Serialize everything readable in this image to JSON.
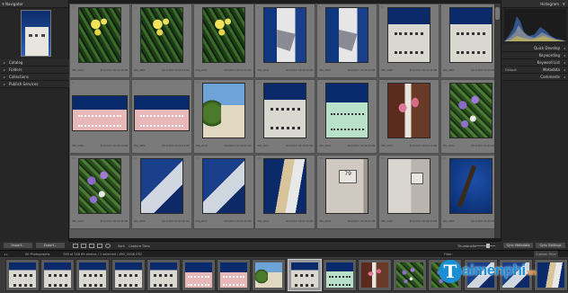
{
  "left_panel": {
    "navigator_label": "Navigator",
    "sections": [
      {
        "label": "Catalog"
      },
      {
        "label": "Folders"
      },
      {
        "label": "Collections"
      },
      {
        "label": "Publish Services"
      }
    ],
    "import_label": "Import...",
    "export_label": "Export..."
  },
  "right_panel": {
    "histogram_label": "Histogram",
    "sections": [
      {
        "label": "Quick Develop"
      },
      {
        "label": "Keywording"
      },
      {
        "label": "Keyword List"
      },
      {
        "label": "Metadata"
      },
      {
        "label": "Comments"
      }
    ],
    "metadata_preset": "Default",
    "sync_label": "Sync Metadata",
    "sync_settings_label": "Sync Settings"
  },
  "grid": {
    "cells": [
      {
        "num": "1",
        "meta1": "IMG_0001",
        "meta2": "8/12/2017 05:22:09 PM",
        "meta3": "",
        "photo": "p-flowers",
        "orient": "portrait"
      },
      {
        "num": "2",
        "meta1": "IMG_0002",
        "meta2": "8/12/2017 05:22:13 PM",
        "meta3": "",
        "photo": "p-flowers",
        "orient": "portrait"
      },
      {
        "num": "3",
        "meta1": "IMG_0003",
        "meta2": "8/12/2017 05:22:15 PM",
        "meta3": "",
        "photo": "p-flowers",
        "orient": "portrait"
      },
      {
        "num": "4",
        "meta1": "IMG_0004",
        "meta2": "8/12/2017 05:28:44 PM",
        "meta3": "",
        "photo": "p-shadow",
        "orient": "portrait"
      },
      {
        "num": "5",
        "meta1": "IMG_0005",
        "meta2": "8/12/2017 05:28:50 PM",
        "meta3": "",
        "photo": "p-shadow",
        "orient": "portrait"
      },
      {
        "num": "6",
        "meta1": "IMG_0006",
        "meta2": "8/12/2017 05:31:02 PM",
        "meta3": "",
        "photo": "p-house-blue",
        "orient": "portrait"
      },
      {
        "num": "7",
        "meta1": "IMG_0007",
        "meta2": "8/12/2017 05:31:06 PM",
        "meta3": "",
        "photo": "p-house-blue",
        "orient": "portrait"
      },
      {
        "num": "8",
        "meta1": "IMG_0008",
        "meta2": "8/12/2017 05:34:10 PM",
        "meta3": "",
        "photo": "p-house-pink",
        "orient": "landscape"
      },
      {
        "num": "9",
        "meta1": "IMG_0009",
        "meta2": "8/12/2017 05:34:14 PM",
        "meta3": "",
        "photo": "p-house-pink",
        "orient": "landscape"
      },
      {
        "num": "10",
        "meta1": "IMG_0010",
        "meta2": "8/12/2017 05:36:20 PM",
        "meta3": "",
        "photo": "p-tree",
        "orient": "portrait"
      },
      {
        "num": "11",
        "meta1": "IMG_0011",
        "meta2": "8/12/2017 05:38:02 PM",
        "meta3": "",
        "photo": "p-house-blue",
        "orient": "portrait"
      },
      {
        "num": "12",
        "meta1": "IMG_0012",
        "meta2": "8/12/2017 05:39:30 PM",
        "meta3": "",
        "photo": "p-house-green",
        "orient": "portrait"
      },
      {
        "num": "13",
        "meta1": "IMG_0013",
        "meta2": "8/12/2017 05:41:11 PM",
        "meta3": "",
        "photo": "p-pink",
        "orient": "portrait"
      },
      {
        "num": "14",
        "meta1": "IMG_0014",
        "meta2": "8/12/2017 05:41:19 PM",
        "meta3": "",
        "photo": "p-purple",
        "orient": "portrait"
      },
      {
        "num": "15",
        "meta1": "IMG_0015",
        "meta2": "8/12/2017 05:43:05 PM",
        "meta3": "",
        "photo": "p-purple",
        "orient": "portrait"
      },
      {
        "num": "16",
        "meta1": "IMG_0016",
        "meta2": "8/12/2017 05:45:40 PM",
        "meta3": "",
        "photo": "p-sculpt",
        "orient": "portrait"
      },
      {
        "num": "17",
        "meta1": "IMG_0017",
        "meta2": "8/12/2017 05:45:48 PM",
        "meta3": "",
        "photo": "p-sculpt",
        "orient": "portrait"
      },
      {
        "num": "18",
        "meta1": "IMG_0018",
        "meta2": "8/12/2017 05:47:12 PM",
        "meta3": "",
        "photo": "p-towers",
        "orient": "portrait"
      },
      {
        "num": "19",
        "meta1": "IMG_0019",
        "meta2": "8/12/2017 05:49:01 PM",
        "meta3": "",
        "photo": "p-sign",
        "orient": "portrait"
      },
      {
        "num": "20",
        "meta1": "IMG_0020",
        "meta2": "8/12/2017 05:49:07 PM",
        "meta3": "",
        "photo": "p-wall",
        "orient": "portrait"
      },
      {
        "num": "21",
        "meta1": "IMG_0021",
        "meta2": "8/12/2017 05:52:33 PM",
        "meta3": "",
        "photo": "p-crane",
        "orient": "portrait"
      }
    ]
  },
  "toolbar": {
    "sort_label": "Sort:",
    "sort_value": "Capture Time",
    "thumbnails_label": "Thumbnails"
  },
  "filmstrip_header": {
    "source": "All Photographs",
    "count": "348 of 348 69 photos / 1 selected / IMG_0006.CR2",
    "filter_label": "Filter:",
    "filter_value": "Custom Filter"
  },
  "filmstrip": {
    "items": [
      {
        "photo": "p-house-blue",
        "selected": false
      },
      {
        "photo": "p-house-blue",
        "selected": false
      },
      {
        "photo": "p-house-blue",
        "selected": false
      },
      {
        "photo": "p-house-blue",
        "selected": false
      },
      {
        "photo": "p-house-blue",
        "selected": false
      },
      {
        "photo": "p-house-pink",
        "selected": false
      },
      {
        "photo": "p-house-pink",
        "selected": false
      },
      {
        "photo": "p-tree",
        "selected": false
      },
      {
        "photo": "p-house-blue",
        "selected": true
      },
      {
        "photo": "p-house-green",
        "selected": false
      },
      {
        "photo": "p-pink",
        "selected": false
      },
      {
        "photo": "p-purple",
        "selected": false
      },
      {
        "photo": "p-purple",
        "selected": false
      },
      {
        "photo": "p-sculpt",
        "selected": false
      },
      {
        "photo": "p-sculpt",
        "selected": false
      },
      {
        "photo": "p-towers",
        "selected": false
      }
    ]
  },
  "logo": {
    "brand": "aimenphi",
    "domain": ".vn",
    "letter": "T"
  },
  "colors": {
    "accent": "#1a8fd6",
    "logo_domain": "#f08a2a",
    "grid_bg": "#5a5a5a",
    "cell_bg": "#7a7a7a",
    "selected_cell": "#9a9a9a",
    "panel_bg": "#262626"
  }
}
